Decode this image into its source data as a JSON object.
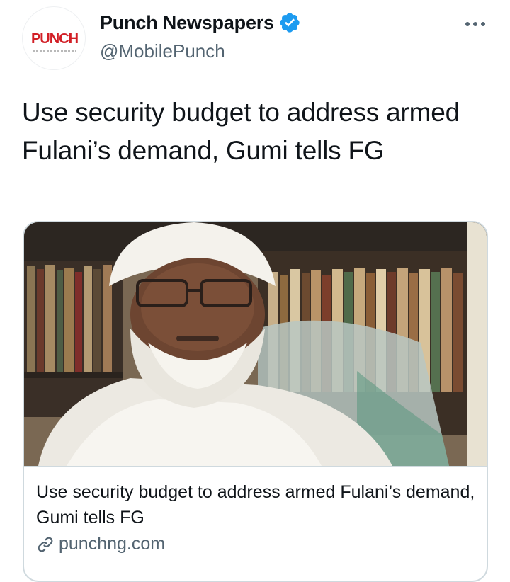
{
  "author": {
    "display_name": "Punch Newspapers",
    "handle": "@MobilePunch",
    "avatar_logo_text": "PUNCH",
    "verified": true
  },
  "tweet": {
    "text": "Use security budget to address armed Fulani’s demand, Gumi tells FG"
  },
  "card": {
    "title": "Use security budget to address armed Fulani’s demand, Gumi tells FG",
    "domain": "punchng.com",
    "image_icon": "news-photo"
  },
  "icons": {
    "verified": "verified-badge-icon",
    "more": "more-options-icon",
    "link": "link-icon"
  },
  "colors": {
    "verified_blue": "#1d9bf0",
    "brand_red": "#d21f26",
    "secondary_text": "#536471",
    "border": "#cfd9de"
  }
}
